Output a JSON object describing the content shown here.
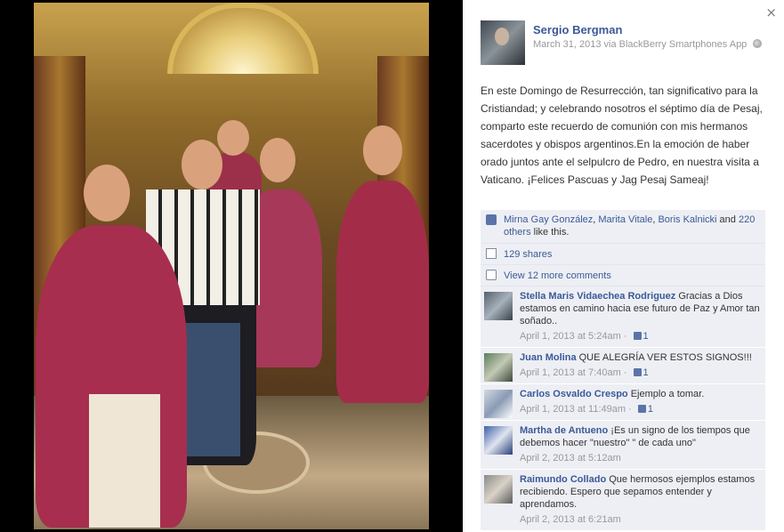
{
  "photo": {
    "subject": ""
  },
  "panel": {
    "close_glyph": "×",
    "author": {
      "name": "Sergio Bergman",
      "date": "March 31, 2013",
      "via": "via BlackBerry Smartphones App"
    },
    "post_text": "En este Domingo de Resurrección, tan significativo para la Cristiandad; y celebrando nosotros el séptimo día de Pesaj, comparto este recuerdo de comunión con mis hermanos sacerdotes y obispos argentinos.En la emoción de haber orado juntos ante el selpulcro de Pedro, en nuestra visita a Vaticano. ¡Felices Pascuas y Jag Pesaj Sameaj!",
    "likes": {
      "names": [
        "Mirna Gay González",
        "Marita Vitale",
        "Boris Kalnicki"
      ],
      "sep": ", ",
      "and": " and ",
      "others": "220 others",
      "suffix": " like this."
    },
    "shares": "129 shares",
    "view_more": "View 12 more comments",
    "comments": [
      {
        "name": "Stella Maris Vidaechea Rodriguez",
        "text": "Gracias a Dios estamos en camino hacia ese futuro de Paz y Amor tan soñado..",
        "date": "April 1, 2013 at 5:24am",
        "likes": "1"
      },
      {
        "name": "Juan Molina",
        "text": "QUE ALEGRÍA VER ESTOS SIGNOS!!!",
        "date": "April 1, 2013 at 7:40am",
        "likes": "1"
      },
      {
        "name": "Carlos Osvaldo Crespo",
        "text": "Ejemplo a tomar.",
        "date": "April 1, 2013 at 11:49am",
        "likes": "1"
      },
      {
        "name": "Martha de Antueno",
        "text": "¡Es un signo de los tiempos que debemos hacer \"nuestro\" \" de cada uno\"",
        "date": "April 2, 2013 at 5:12am",
        "likes": ""
      },
      {
        "name": "Raimundo Collado",
        "text": "Que hermosos ejemplos estamos recibiendo. Espero que sepamos entender y aprendamos.",
        "date": "April 2, 2013 at 6:21am",
        "likes": ""
      }
    ]
  },
  "icons": {
    "close": "close-icon",
    "like": "thumbs-up-icon",
    "share": "share-icon",
    "comment": "comment-icon",
    "privacy": "globe-icon"
  },
  "colors": {
    "link": "#3b5998",
    "ufi_background": "#edeff4",
    "meta_text": "#999999"
  }
}
